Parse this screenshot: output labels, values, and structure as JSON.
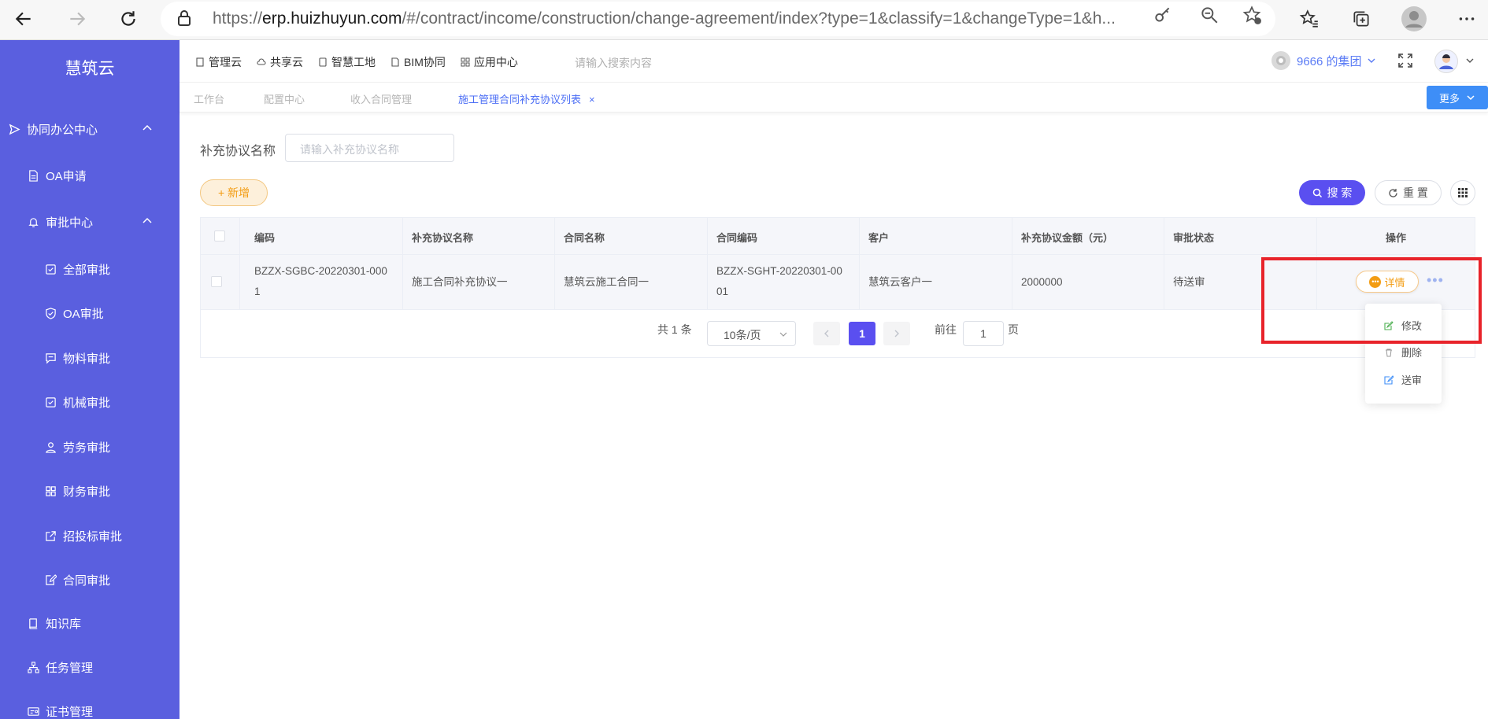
{
  "browser": {
    "url_prefix": "https://",
    "url_host": "erp.huizhuyun.com",
    "url_path": "/#/contract/income/construction/change-agreement/index?type=1&classify=1&changeType=1&h..."
  },
  "brand": "慧筑云",
  "sidebar": {
    "items": [
      {
        "label": "协同办公中心",
        "icon": "send-icon"
      },
      {
        "label": "OA申请",
        "icon": "document-icon"
      },
      {
        "label": "审批中心",
        "icon": "bell-icon"
      },
      {
        "label": "全部审批",
        "icon": "checkbox-icon"
      },
      {
        "label": "OA审批",
        "icon": "shield-check-icon"
      },
      {
        "label": "物料审批",
        "icon": "chat-icon"
      },
      {
        "label": "机械审批",
        "icon": "checkbox-icon"
      },
      {
        "label": "劳务审批",
        "icon": "user-icon"
      },
      {
        "label": "财务审批",
        "icon": "grid-icon"
      },
      {
        "label": "招投标审批",
        "icon": "external-link-icon"
      },
      {
        "label": "合同审批",
        "icon": "edit-document-icon"
      },
      {
        "label": "知识库",
        "icon": "book-icon"
      },
      {
        "label": "任务管理",
        "icon": "org-chart-icon"
      },
      {
        "label": "证书管理",
        "icon": "certificate-icon"
      }
    ]
  },
  "topnav": {
    "items": [
      "管理云",
      "共享云",
      "智慧工地",
      "BIM协同",
      "应用中心"
    ],
    "search_placeholder": "请输入搜索内容",
    "group": "9666 的集团"
  },
  "tabs": {
    "items": [
      "工作台",
      "配置中心",
      "收入合同管理",
      "施工管理合同补充协议列表"
    ],
    "more": "更多"
  },
  "filter": {
    "label": "补充协议名称",
    "placeholder": "请输入补充协议名称"
  },
  "buttons": {
    "add": "+ 新增",
    "search": "搜 索",
    "reset": "重 置"
  },
  "table": {
    "headers": [
      "编码",
      "补充协议名称",
      "合同名称",
      "合同编码",
      "客户",
      "补充协议金额（元）",
      "审批状态",
      "操作"
    ],
    "row": {
      "code_line1": "BZZX-SGBC-20220301-000",
      "code_line2": "1",
      "agreement_name": "施工合同补充协议一",
      "contract_name": "慧筑云施工合同一",
      "contract_code_line1": "BZZX-SGHT-20220301-00",
      "contract_code_line2": "01",
      "customer": "慧筑云客户一",
      "amount": "2000000",
      "status": "待送审",
      "detail": "详情"
    }
  },
  "pagination": {
    "total": "共 1 条",
    "page_size": "10条/页",
    "current": "1",
    "goto_prefix": "前往",
    "goto_value": "1",
    "goto_suffix": "页"
  },
  "dropdown": {
    "items": [
      "修改",
      "删除",
      "送审"
    ]
  },
  "colors": {
    "sidebar_bg": "#5a5fdf",
    "primary": "#5a4ff0",
    "accent_orange": "#f39c12",
    "highlight_red": "#e8232a"
  }
}
